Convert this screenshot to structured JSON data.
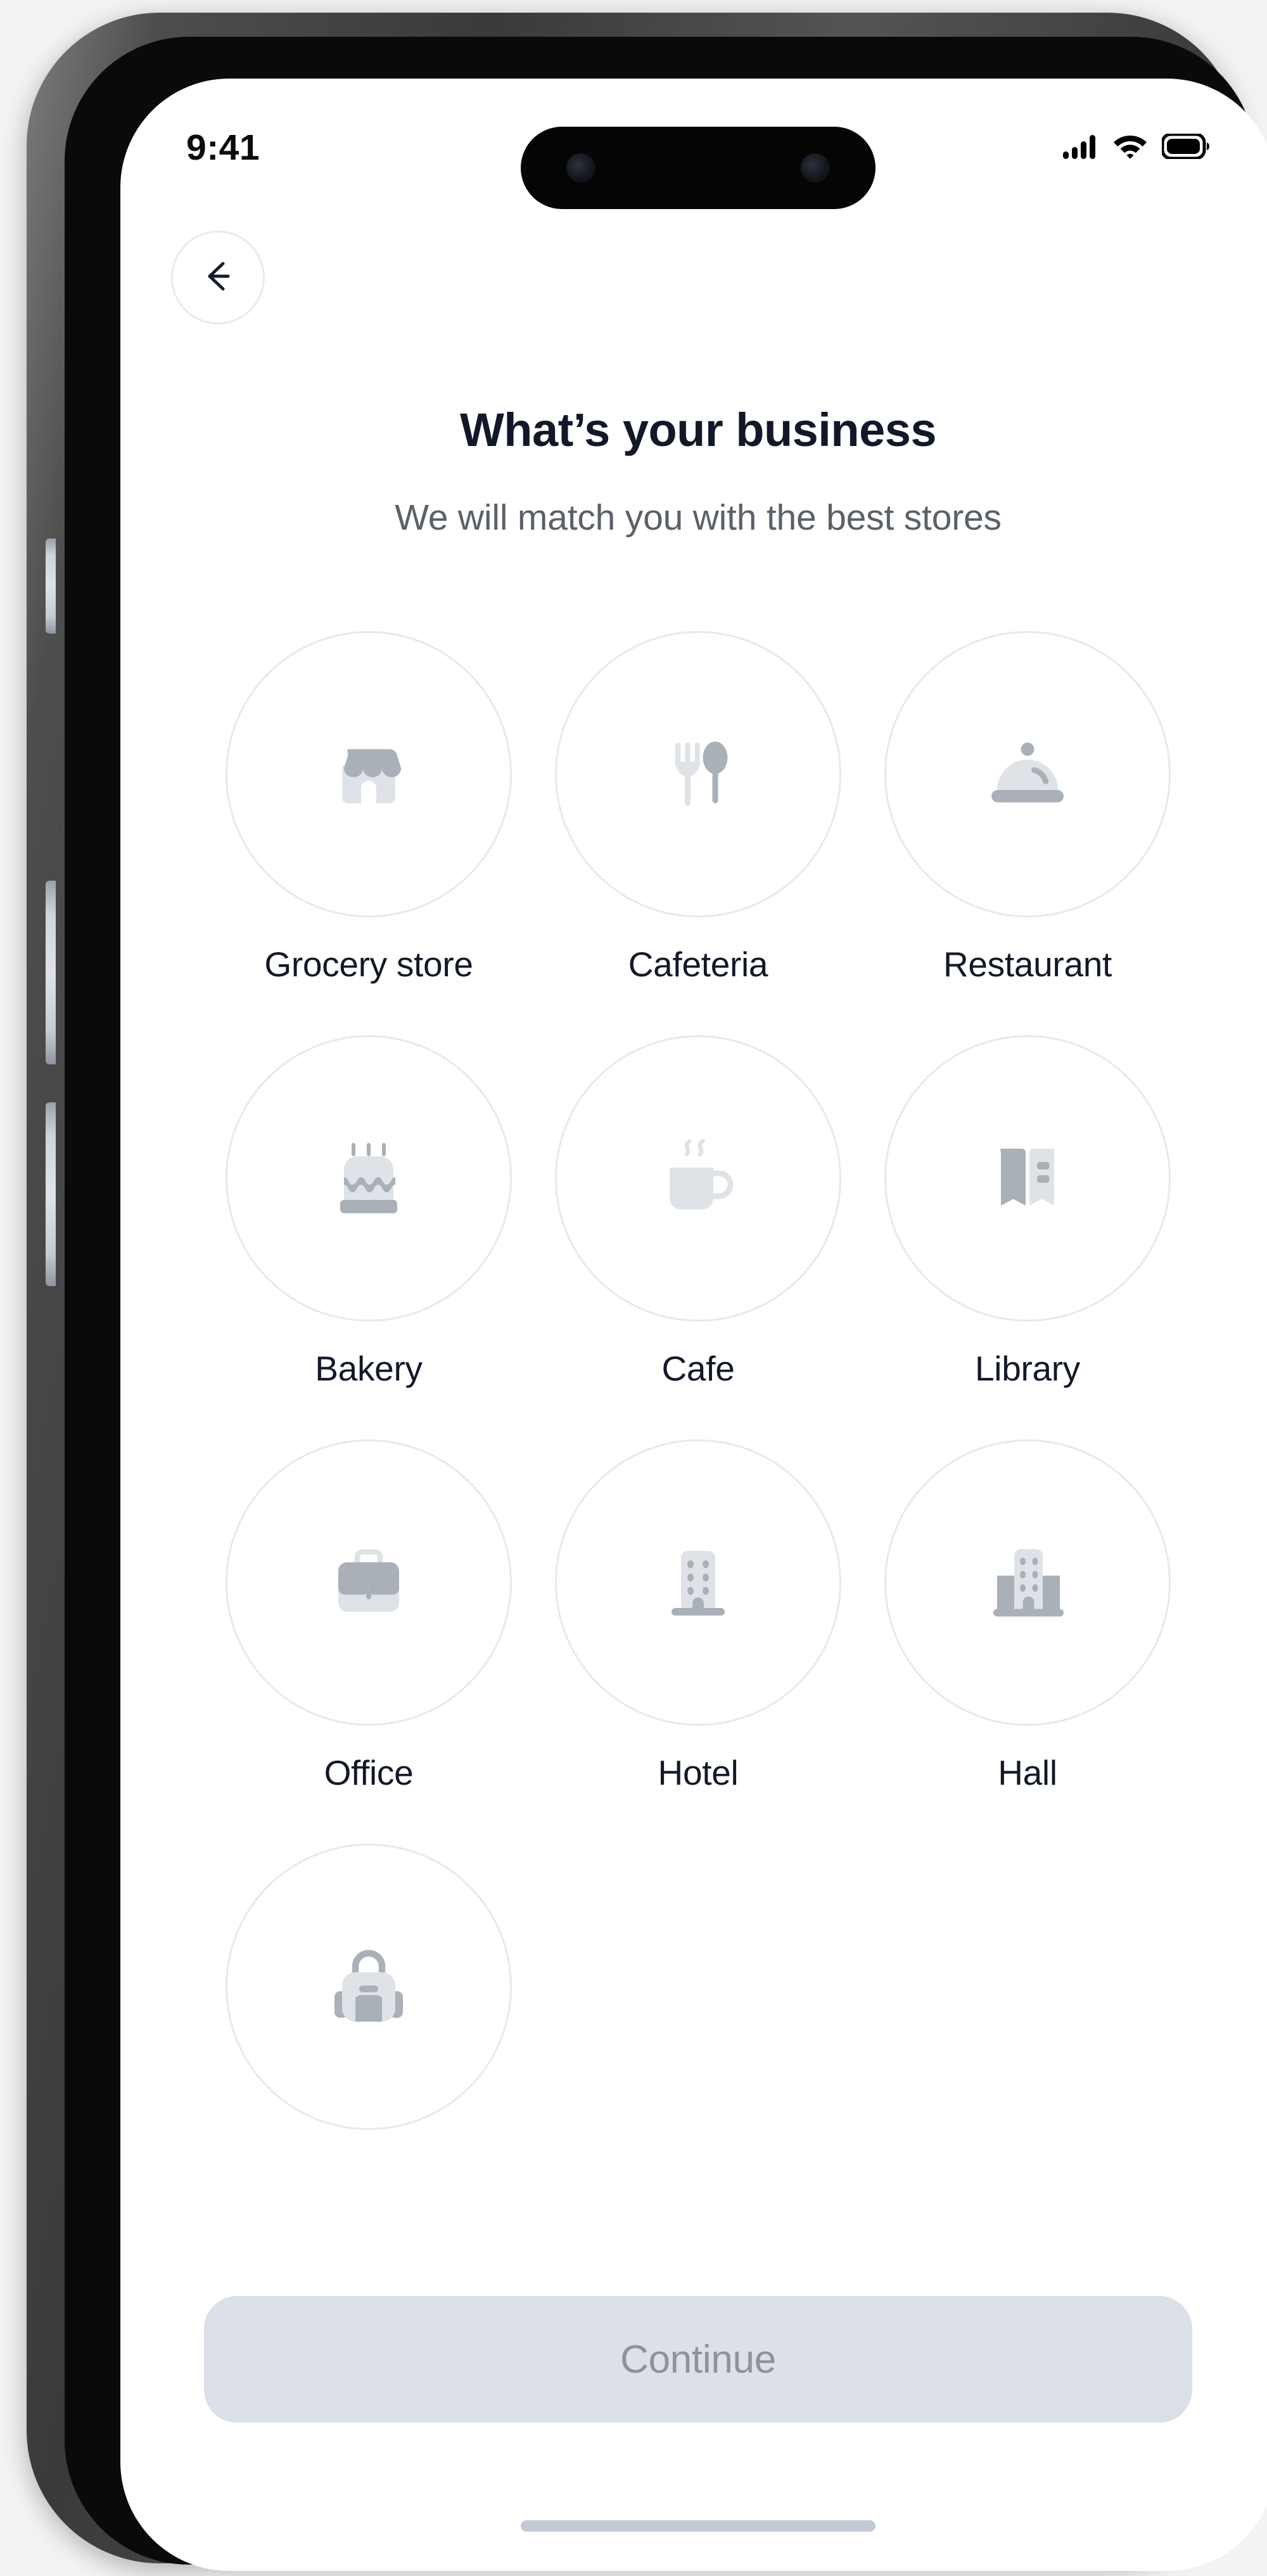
{
  "status_bar": {
    "time": "9:41",
    "icons": [
      "cellular-signal-icon",
      "wifi-icon",
      "battery-icon"
    ],
    "battery_level": 100
  },
  "header": {
    "back_icon": "arrow-left-icon",
    "title": "What’s your business",
    "subtitle": "We will match you with the best stores"
  },
  "business_grid": {
    "items": [
      {
        "label": "Grocery store",
        "icon": "storefront-icon"
      },
      {
        "label": "Cafeteria",
        "icon": "fork-spoon-icon"
      },
      {
        "label": "Restaurant",
        "icon": "cloche-icon"
      },
      {
        "label": "Bakery",
        "icon": "cake-icon"
      },
      {
        "label": "Cafe",
        "icon": "coffee-mug-icon"
      },
      {
        "label": "Library",
        "icon": "open-book-icon"
      },
      {
        "label": "Office",
        "icon": "briefcase-icon"
      },
      {
        "label": "Hotel",
        "icon": "hotel-building-icon"
      },
      {
        "label": "Hall",
        "icon": "hall-building-icon"
      },
      {
        "label": "",
        "icon": "backpack-icon"
      }
    ]
  },
  "footer": {
    "continue_label": "Continue",
    "continue_enabled": false
  },
  "colors": {
    "title": "#121829",
    "subtitle": "#5b6069",
    "circle_border": "#e6e9ee",
    "icon_light": "#dfe3e8",
    "icon_dark": "#aab0b8",
    "button_disabled_bg": "#dce0e8",
    "button_disabled_text": "#8d929c",
    "home_indicator": "#c3c9d4",
    "page_background": "#f2f3f5"
  }
}
